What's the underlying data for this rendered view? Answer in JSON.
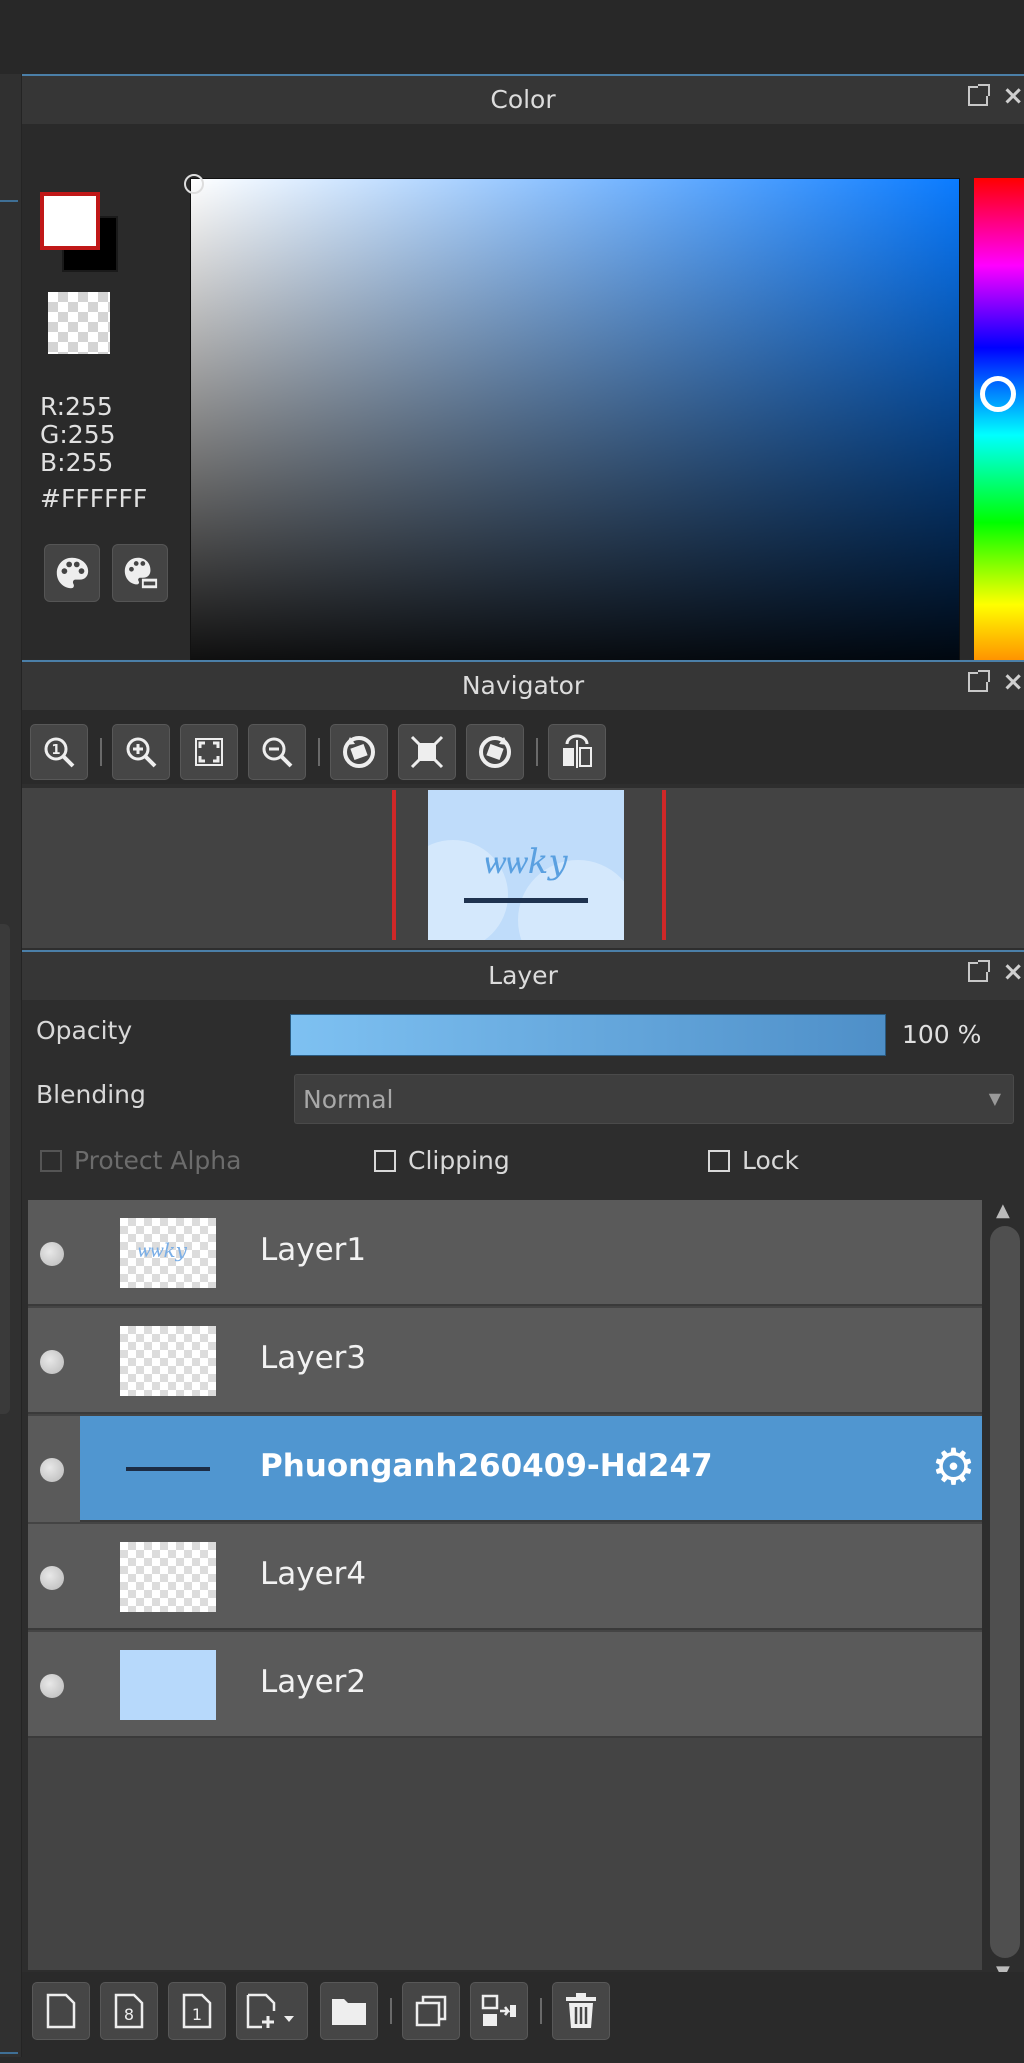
{
  "color_panel": {
    "title": "Color",
    "r": "R:255",
    "g": "G:255",
    "b": "B:255",
    "hex": "#FFFFFF",
    "foreground_color": "#FFFFFF",
    "background_color": "#000000",
    "hue_color": "#0A7BFF"
  },
  "navigator_panel": {
    "title": "Navigator",
    "tools": [
      "zoom-actual-icon",
      "zoom-in-icon",
      "fit-screen-icon",
      "zoom-out-icon",
      "rotate-left-icon",
      "fullscreen-icon",
      "rotate-right-icon",
      "flip-horizontal-icon"
    ]
  },
  "layer_panel": {
    "title": "Layer",
    "opacity_label": "Opacity",
    "opacity_value": "100 %",
    "opacity_fraction": 1.0,
    "blending_label": "Blending",
    "blending_value": "Normal",
    "protect_alpha_label": "Protect Alpha",
    "clipping_label": "Clipping",
    "lock_label": "Lock",
    "layers": [
      {
        "name": "Layer1",
        "selected": false
      },
      {
        "name": "Layer3",
        "selected": false
      },
      {
        "name": "Phuonganh260409-Hd247",
        "selected": true
      },
      {
        "name": "Layer4",
        "selected": false
      },
      {
        "name": "Layer2",
        "selected": false
      }
    ],
    "selected_color": "#5096D0",
    "bottom_tools": [
      "new-layer-icon",
      "new-8bit-layer-icon",
      "new-1bit-layer-icon",
      "add-layer-menu-icon",
      "new-folder-icon",
      "duplicate-layer-icon",
      "merge-down-icon",
      "delete-layer-icon"
    ]
  }
}
